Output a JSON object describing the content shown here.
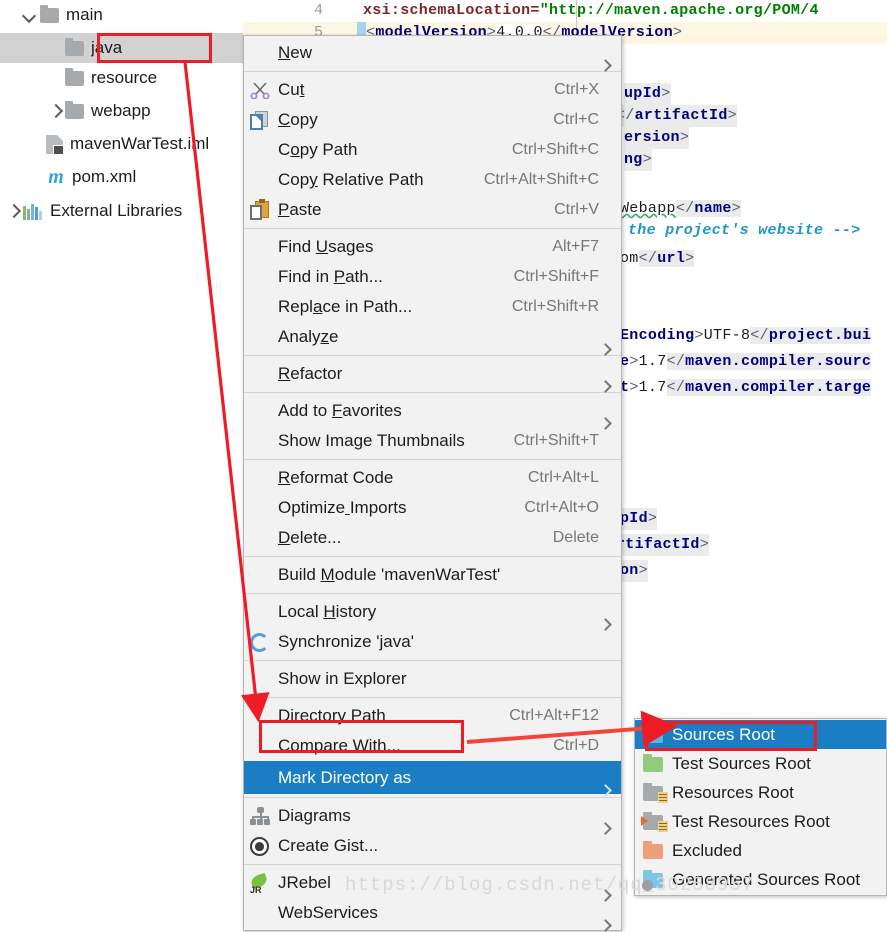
{
  "project_tree": {
    "items": [
      {
        "label": "main",
        "icon": "folder-icon",
        "chevron": "down",
        "indent": 40,
        "selected": false
      },
      {
        "label": "java",
        "icon": "folder-icon",
        "chevron": "none",
        "indent": 65,
        "selected": true
      },
      {
        "label": "resource",
        "icon": "folder-icon",
        "chevron": "none",
        "indent": 65,
        "selected": false
      },
      {
        "label": "webapp",
        "icon": "folder-icon",
        "chevron": "right",
        "indent": 65,
        "selected": false
      },
      {
        "label": "mavenWarTest.iml",
        "icon": "iml-icon",
        "chevron": "none",
        "indent": 46,
        "selected": false
      },
      {
        "label": "pom.xml",
        "icon": "maven-m-icon",
        "chevron": "none",
        "indent": 46,
        "selected": false
      },
      {
        "label": "External Libraries",
        "icon": "libraries-icon",
        "chevron": "right",
        "indent": 23,
        "selected": false
      }
    ]
  },
  "editor": {
    "gutter_lines": [
      "4",
      "5"
    ],
    "lines": [
      {
        "no": "4",
        "text": "xsi:schemaLocation=\"http://maven.apache.org/POM/4"
      },
      {
        "no": "5",
        "text": "<modelVersion>4.0.0</modelVersion>"
      },
      {
        "no": "",
        "text": "upId>"
      },
      {
        "no": "",
        "text": "</artifactId>"
      },
      {
        "no": "",
        "text": "ersion>"
      },
      {
        "no": "",
        "text": "ng>"
      },
      {
        "no": "",
        "text": "Webapp</name>"
      },
      {
        "no": "",
        "text": "the project's website -->"
      },
      {
        "no": "",
        "text": "om</url>"
      },
      {
        "no": "",
        "text": "Encoding>UTF-8</project.bui"
      },
      {
        "no": "",
        "text": "e>1.7</maven.compiler.sourc"
      },
      {
        "no": "",
        "text": "t>1.7</maven.compiler.targe"
      },
      {
        "no": "",
        "text": "pId>"
      },
      {
        "no": "",
        "text": "rtifactId>"
      },
      {
        "no": "",
        "text": "on>"
      }
    ]
  },
  "context_menu": {
    "items": [
      {
        "label": "New",
        "accel": "",
        "submenu": true,
        "icon": "",
        "sep_after": true,
        "u": 0
      },
      {
        "label": "Cut",
        "accel": "Ctrl+X",
        "submenu": false,
        "icon": "cut-icon",
        "u": 2
      },
      {
        "label": "Copy",
        "accel": "Ctrl+C",
        "submenu": false,
        "icon": "copy-icon",
        "u": 0
      },
      {
        "label": "Copy Path",
        "accel": "Ctrl+Shift+C",
        "submenu": false,
        "icon": "",
        "u": 1
      },
      {
        "label": "Copy Relative Path",
        "accel": "Ctrl+Alt+Shift+C",
        "submenu": false,
        "icon": "",
        "u": 3
      },
      {
        "label": "Paste",
        "accel": "Ctrl+V",
        "submenu": false,
        "icon": "paste-icon",
        "u": 0,
        "sep_after": true
      },
      {
        "label": "Find Usages",
        "accel": "Alt+F7",
        "submenu": false,
        "icon": "",
        "u": 5
      },
      {
        "label": "Find in Path...",
        "accel": "Ctrl+Shift+F",
        "submenu": false,
        "icon": "",
        "u": 8
      },
      {
        "label": "Replace in Path...",
        "accel": "Ctrl+Shift+R",
        "submenu": false,
        "icon": "",
        "u": 4
      },
      {
        "label": "Analyze",
        "accel": "",
        "submenu": true,
        "icon": "",
        "u": 5,
        "sep_after": true
      },
      {
        "label": "Refactor",
        "accel": "",
        "submenu": true,
        "icon": "",
        "u": 0,
        "sep_after": true
      },
      {
        "label": "Add to Favorites",
        "accel": "",
        "submenu": true,
        "icon": "",
        "u": 7
      },
      {
        "label": "Show Image Thumbnails",
        "accel": "Ctrl+Shift+T",
        "submenu": false,
        "icon": "",
        "u": -1,
        "sep_after": true
      },
      {
        "label": "Reformat Code",
        "accel": "Ctrl+Alt+L",
        "submenu": false,
        "icon": "",
        "u": 0
      },
      {
        "label": "Optimize Imports",
        "accel": "Ctrl+Alt+O",
        "submenu": false,
        "icon": "",
        "u": 8
      },
      {
        "label": "Delete...",
        "accel": "Delete",
        "submenu": false,
        "icon": "",
        "u": 0,
        "sep_after": true
      },
      {
        "label": "Build Module 'mavenWarTest'",
        "accel": "",
        "submenu": false,
        "icon": "",
        "u": 6,
        "sep_after": true
      },
      {
        "label": "Local History",
        "accel": "",
        "submenu": true,
        "icon": "",
        "u": 6
      },
      {
        "label": "Synchronize 'java'",
        "accel": "",
        "submenu": false,
        "icon": "sync-icon",
        "u": -1,
        "sep_after": true
      },
      {
        "label": "Show in Explorer",
        "accel": "",
        "submenu": false,
        "icon": "",
        "u": -1,
        "sep_after": true
      },
      {
        "label": "Directory Path",
        "accel": "Ctrl+Alt+F12",
        "submenu": false,
        "icon": "",
        "u": 10
      },
      {
        "label": "Compare With...",
        "accel": "Ctrl+D",
        "submenu": false,
        "icon": "",
        "u": -1
      },
      {
        "label": "Mark Directory as",
        "accel": "",
        "submenu": true,
        "icon": "",
        "u": -1,
        "highlight": true,
        "sep_after": true
      },
      {
        "label": "Diagrams",
        "accel": "",
        "submenu": true,
        "icon": "diagram-icon",
        "u": -1
      },
      {
        "label": "Create Gist...",
        "accel": "",
        "submenu": false,
        "icon": "gist-icon",
        "u": -1,
        "sep_after": true
      },
      {
        "label": "JRebel",
        "accel": "",
        "submenu": true,
        "icon": "jrebel-icon",
        "u": -1
      },
      {
        "label": "WebServices",
        "accel": "",
        "submenu": true,
        "icon": "",
        "u": -1
      }
    ]
  },
  "submenu": {
    "items": [
      {
        "label": "Sources Root",
        "icon_color": "blue",
        "highlight": true
      },
      {
        "label": "Test Sources Root",
        "icon_color": "green",
        "highlight": false
      },
      {
        "label": "Resources Root",
        "icon_color": "gray",
        "lines": true,
        "highlight": false
      },
      {
        "label": "Test Resources Root",
        "icon_color": "gray",
        "lines": true,
        "arrow": true,
        "highlight": false
      },
      {
        "label": "Excluded",
        "icon_color": "orange",
        "highlight": false
      },
      {
        "label": "Generated Sources Root",
        "icon_color": "cyan",
        "gear": true,
        "highlight": false
      }
    ]
  },
  "annotations": {
    "highlight_color": "#ee1c25",
    "selection_color": "#1b7ec4",
    "arrow_from_java_to_mark": "java-to-mark-directory",
    "arrow_mark_to_sources": "mark-directory-to-sources-root"
  },
  "watermark": {
    "text": "https://blog.csdn.net/qq_30258957"
  }
}
